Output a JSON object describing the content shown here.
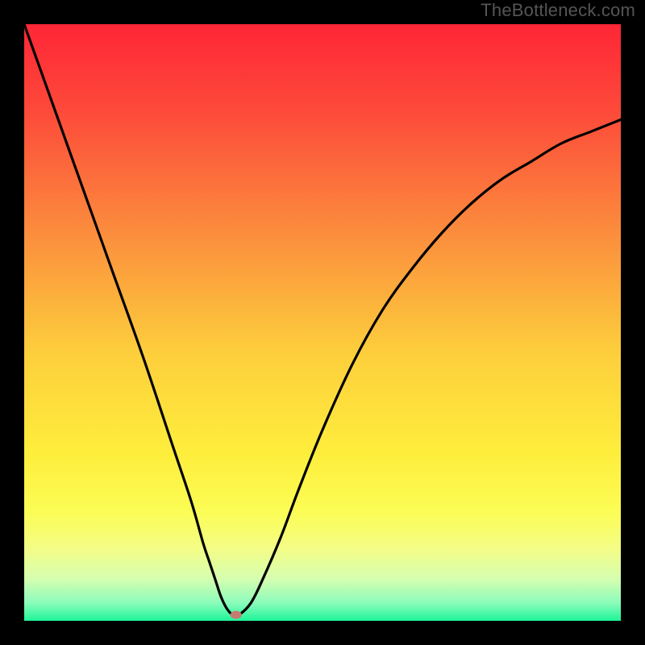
{
  "watermark": "TheBottleneck.com",
  "chart_data": {
    "type": "line",
    "title": "",
    "xlabel": "",
    "ylabel": "",
    "xlim": [
      0,
      100
    ],
    "ylim": [
      0,
      100
    ],
    "grid": false,
    "series": [
      {
        "name": "curve",
        "color": "#000000",
        "x": [
          0,
          5,
          10,
          15,
          20,
          25,
          28,
          30,
          31,
          32,
          33,
          34,
          35,
          36,
          38,
          40,
          43,
          46,
          50,
          55,
          60,
          65,
          70,
          75,
          80,
          85,
          90,
          95,
          100
        ],
        "values": [
          100,
          86,
          72,
          58,
          44,
          29,
          20,
          13,
          10,
          7,
          4,
          2,
          1,
          1,
          3,
          7,
          14,
          22,
          32,
          43,
          52,
          59,
          65,
          70,
          74,
          77,
          80,
          82,
          84
        ]
      }
    ],
    "marker": {
      "x": 35.5,
      "y": 1,
      "color": "#c77a71",
      "rx": 7,
      "ry": 5
    },
    "background_gradient": {
      "type": "vertical",
      "stops": [
        {
          "offset": 0.0,
          "color": "#fe2636"
        },
        {
          "offset": 0.15,
          "color": "#fd4b3a"
        },
        {
          "offset": 0.35,
          "color": "#fb8d3d"
        },
        {
          "offset": 0.55,
          "color": "#fdce3c"
        },
        {
          "offset": 0.72,
          "color": "#feee3c"
        },
        {
          "offset": 0.82,
          "color": "#fbfd56"
        },
        {
          "offset": 0.88,
          "color": "#f3fd87"
        },
        {
          "offset": 0.93,
          "color": "#d5feb0"
        },
        {
          "offset": 0.97,
          "color": "#8bfcbb"
        },
        {
          "offset": 1.0,
          "color": "#1ef498"
        }
      ]
    }
  }
}
